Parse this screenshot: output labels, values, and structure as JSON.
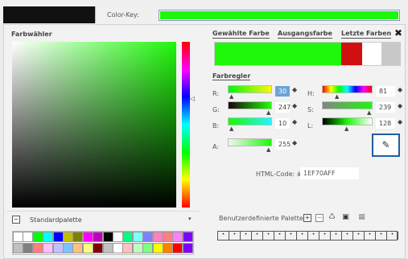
{
  "color_key": {
    "label": "Color-Key:",
    "color": "#1ef70a"
  },
  "picker": {
    "title": "Farbwähler"
  },
  "tabs": [
    "Gewählte Farbe",
    "Ausgangsfarbe",
    "Letzte Farben"
  ],
  "close_glyph": "✖",
  "selected": {
    "new_color": "#1ef70a",
    "original_color": "#d01010"
  },
  "regler": {
    "title": "Farbregler",
    "labels": [
      "R:",
      "G:",
      "B:",
      "A:",
      "H:",
      "S:",
      "L:"
    ],
    "values": [
      "30",
      "247",
      "10",
      "255",
      "81",
      "239",
      "128"
    ]
  },
  "hex": {
    "label": "HTML-Code: #",
    "value": "1EF70AFF"
  },
  "palette": {
    "name": "Standardpalette",
    "colors": [
      [
        "#ffffff",
        "#ffffff",
        "#00ff00",
        "#00ffff",
        "#0000ff",
        "#c0c000",
        "#808000",
        "#ff00ff",
        "#c000c0",
        "#000000",
        "#ffffff",
        "#00ff80",
        "#80ffff",
        "#8080ff",
        "#ff80c0",
        "#ff8080",
        "#ff80ff",
        "#8000ff"
      ],
      [
        "#c0c0c0",
        "#808080",
        "#ff8080",
        "#ffc0ff",
        "#c0c0ff",
        "#80c0ff",
        "#ffc080",
        "#ffff80",
        "#800000",
        "#c0c0c0",
        "#ffffff",
        "#ffc0c0",
        "#c0ffc0",
        "#80ff80",
        "#ffff00",
        "#ff8000",
        "#ff0000",
        "#8000ff"
      ]
    ]
  },
  "custom_palette": {
    "title": "Benutzerdefinierte Palette",
    "cell_glyph": "•",
    "count": 16
  }
}
